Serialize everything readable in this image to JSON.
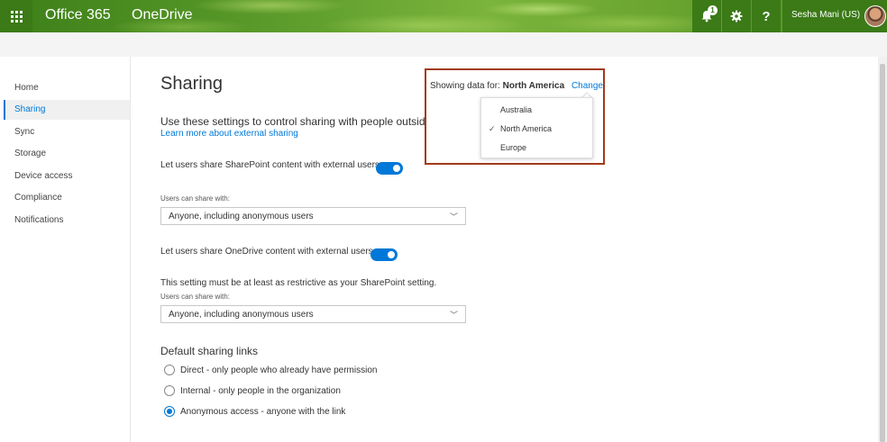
{
  "header": {
    "brand": "Office 365",
    "app": "OneDrive",
    "notification_count": "1",
    "help_label": "?",
    "user_name": "Sesha Mani (US)"
  },
  "nav": {
    "items": [
      {
        "label": "Home"
      },
      {
        "label": "Sharing"
      },
      {
        "label": "Sync"
      },
      {
        "label": "Storage"
      },
      {
        "label": "Device access"
      },
      {
        "label": "Compliance"
      },
      {
        "label": "Notifications"
      }
    ],
    "selected": "Sharing"
  },
  "main": {
    "title": "Sharing",
    "description": "Use these settings to control sharing with people outside your organization.",
    "learn_more": "Learn more about external sharing",
    "sharepoint_toggle_label": "Let users share SharePoint content with external users",
    "sharepoint_toggle_on": true,
    "users_can_share_label_1": "Users can share with:",
    "sharepoint_share_value": "Anyone, including anonymous users",
    "onedrive_toggle_label": "Let users share OneDrive content with external users",
    "onedrive_toggle_on": true,
    "restrictive_note": "This setting must be at least as restrictive as your SharePoint setting.",
    "users_can_share_label_2": "Users can share with:",
    "onedrive_share_value": "Anyone, including anonymous users",
    "default_links_title": "Default sharing links",
    "radio_options": [
      {
        "label": "Direct - only people who already have permission",
        "checked": false
      },
      {
        "label": "Internal - only people in the organization",
        "checked": false
      },
      {
        "label": "Anonymous access - anyone with the link",
        "checked": true
      }
    ]
  },
  "region": {
    "showing_label": "Showing data for:",
    "current": "North America",
    "change": "Change",
    "options": [
      {
        "label": "Australia",
        "selected": false
      },
      {
        "label": "North America",
        "selected": true
      },
      {
        "label": "Europe",
        "selected": false
      }
    ],
    "check_mark": "✓"
  },
  "colors": {
    "accent": "#0078d7",
    "header": "#4a8b1e",
    "highlight_border": "#a33a1a"
  }
}
